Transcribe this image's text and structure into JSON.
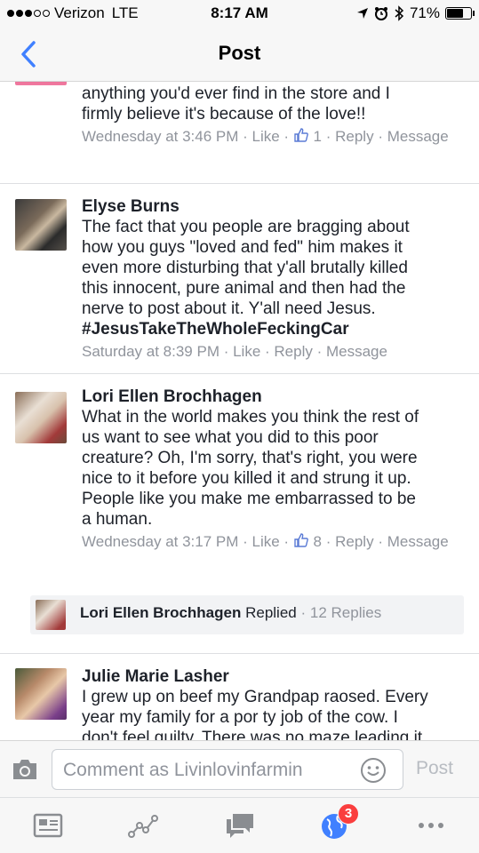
{
  "status_bar": {
    "carrier": "Verizon",
    "network": "LTE",
    "time": "8:17 AM",
    "battery": "71%",
    "battery_level": 0.71,
    "signal_bars": 3
  },
  "nav": {
    "title": "Post",
    "back_icon": "chevron-left-icon"
  },
  "comments": [
    {
      "name": "",
      "text": "anything you'd ever find in the store and I\nfirmly believe it's because of the love!!",
      "time": "Wednesday at 3:46 PM",
      "like_label": "Like",
      "like_count": "1",
      "reply_label": "Reply",
      "message_label": "Message"
    },
    {
      "name": "Elyse Burns",
      "text": "The fact that you people are bragging about\nhow you guys \"loved and fed\" him makes it\neven more disturbing that y'all brutally killed\nthis innocent, pure animal and then had the\nnerve to post about it. Y'all need Jesus.",
      "hashtag": "#JesusTakeTheWholeFeckingCar",
      "time": "Saturday at 8:39 PM",
      "like_label": "Like",
      "reply_label": "Reply",
      "message_label": "Message"
    },
    {
      "name": "Lori Ellen Brochhagen",
      "text": "What in the world makes you think the rest of\nus want to see what you did to this poor\ncreature?  Oh, I'm sorry, that's right, you were\nnice to it before you killed it and strung it up.\nPeople like you make me embarrassed to  be\na human.",
      "time": "Wednesday at 3:17 PM",
      "like_label": "Like",
      "like_count": "8",
      "reply_label": "Reply",
      "message_label": "Message",
      "replied": {
        "name": "Lori Ellen Brochhagen",
        "action": "Replied",
        "count": "12 Replies"
      }
    },
    {
      "name": "Julie Marie Lasher",
      "text": "I grew up on beef my Grandpap raosed. Every\nyear my family for a por ty job of the cow. I\ndon't feel guilty. There was no maze leading it"
    }
  ],
  "composer": {
    "placeholder": "Comment as Livinlovinfarmin",
    "post_label": "Post"
  },
  "tabs": [
    {
      "icon": "news-feed-icon"
    },
    {
      "icon": "activity-icon"
    },
    {
      "icon": "messages-icon"
    },
    {
      "icon": "globe-notifications-icon",
      "badge": "3"
    },
    {
      "icon": "more-icon"
    }
  ],
  "colors": {
    "accent": "#4080ff",
    "meta_text": "#90949c",
    "badge": "#fa3e3e"
  }
}
